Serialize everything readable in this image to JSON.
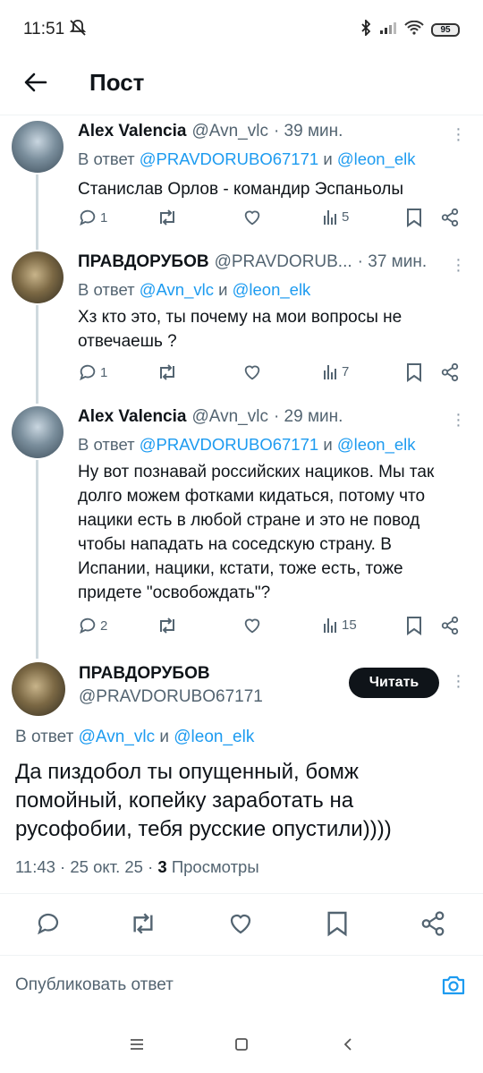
{
  "status_bar": {
    "time": "11:51",
    "battery": "95"
  },
  "header": {
    "title": "Пост"
  },
  "tweets": [
    {
      "name": "Alex Valencia",
      "handle": "@Avn_vlc",
      "time": "· 39 мин.",
      "reply_prefix": "В ответ ",
      "reply_user1": "@PRAVDORUBO67171",
      "reply_and": " и ",
      "reply_user2": "@leon_elk",
      "text": "Станислав Орлов - командир Эспаньолы",
      "replies": "1",
      "retweets": "",
      "likes": "",
      "views": "5"
    },
    {
      "name": "ПРАВДОРУБОВ",
      "handle": "@PRAVDORUB...",
      "time": "· 37 мин.",
      "reply_prefix": "В ответ ",
      "reply_user1": "@Avn_vlc",
      "reply_and": " и ",
      "reply_user2": "@leon_elk",
      "text": "Хз кто это, ты почему на мои вопросы не отвечаешь ?",
      "replies": "1",
      "retweets": "",
      "likes": "",
      "views": "7"
    },
    {
      "name": "Alex Valencia",
      "handle": "@Avn_vlc",
      "time": "· 29 мин.",
      "reply_prefix": "В ответ ",
      "reply_user1": "@PRAVDORUBO67171",
      "reply_and": " и ",
      "reply_user2": "@leon_elk",
      "text": "Ну вот познавай российских нациков. Мы так долго можем фотками кидаться, потому что нацики есть в любой стране и это не повод чтобы нападать на соседскую страну. В Испании, нацики, кстати, тоже есть, тоже придете \"освобождать\"?",
      "replies": "2",
      "retweets": "",
      "likes": "",
      "views": "15"
    }
  ],
  "focus": {
    "name": "ПРАВДОРУБОВ",
    "handle": "@PRAVDORUBO67171",
    "follow_label": "Читать",
    "reply_prefix": "В ответ ",
    "reply_user1": "@Avn_vlc",
    "reply_and": " и ",
    "reply_user2": "@leon_elk",
    "text": "Да пиздобол ты опущенный, бомж помойный, копейку заработать на русофобии, тебя русские опустили))))",
    "time": "11:43 · 25 окт. 25 · ",
    "views_count": "3",
    "views_label": " Просмотры"
  },
  "compose": {
    "placeholder": "Опубликовать ответ"
  },
  "colors": {
    "accent": "#1d9bf0",
    "text": "#0f1419",
    "muted": "#536471"
  }
}
